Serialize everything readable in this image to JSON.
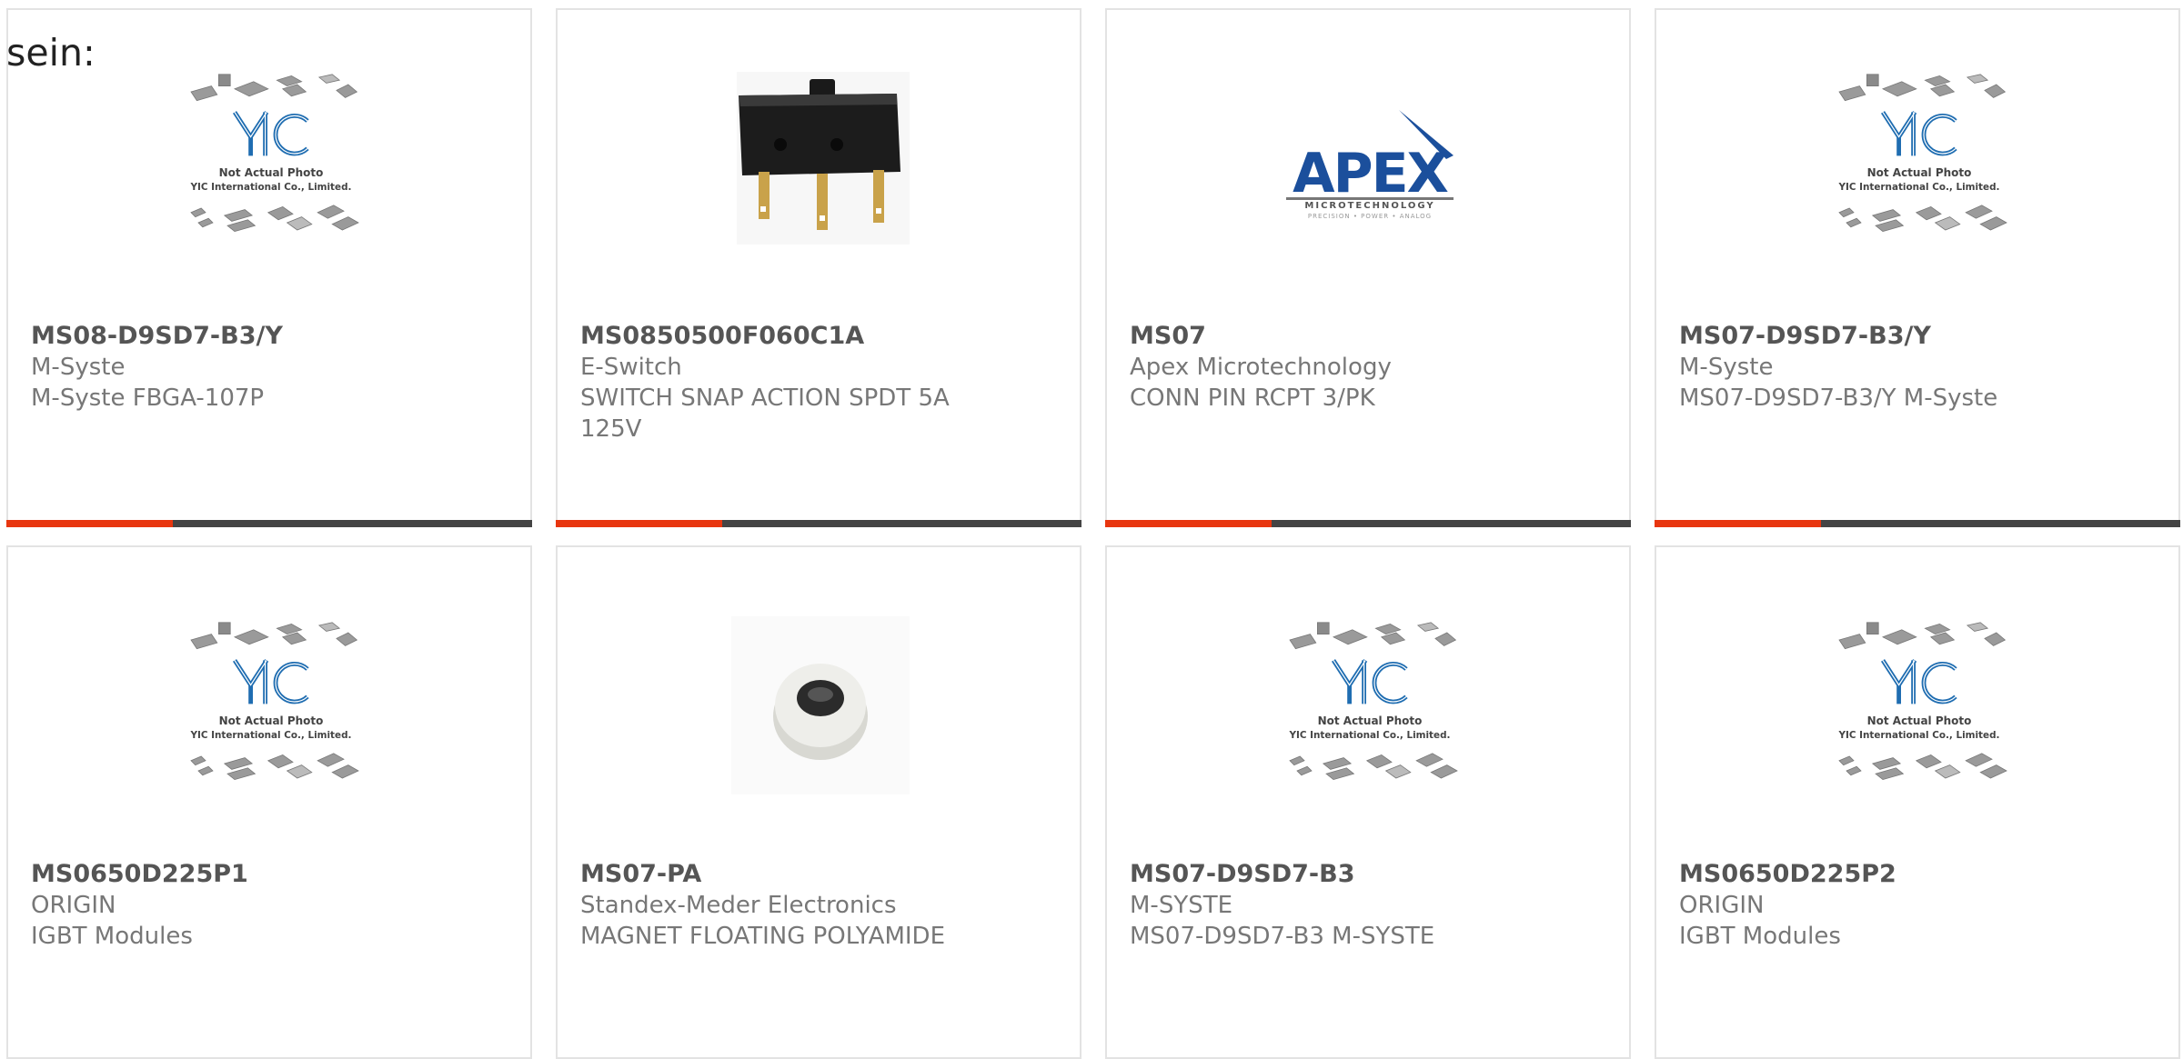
{
  "heading": "sein:",
  "colors": {
    "accent": "#e8360f",
    "bar": "#444444",
    "border": "#e3e3e3",
    "yic_blue": "#1f6db1",
    "apex_blue": "#1b4f9c"
  },
  "placeholder": {
    "line1": "Not Actual Photo",
    "line2": "YIC International Co., Limited.",
    "logo": "YIC"
  },
  "apex_logo": {
    "name": "APEX",
    "tagline": "MICROTECHNOLOGY",
    "sub": "PRECISION • POWER • ANALOG"
  },
  "products": [
    {
      "part_number": "MS08-D9SD7-B3/Y",
      "manufacturer": "M-Syste",
      "description": "M-Syste FBGA-107P",
      "image": "not-actual-photo"
    },
    {
      "part_number": "MS0850500F060C1A",
      "manufacturer": "E-Switch",
      "description": "SWITCH SNAP ACTION SPDT 5A 125V",
      "image": "snap-switch"
    },
    {
      "part_number": "MS07",
      "manufacturer": "Apex Microtechnology",
      "description": "CONN PIN RCPT 3/PK",
      "image": "apex-logo"
    },
    {
      "part_number": "MS07-D9SD7-B3/Y",
      "manufacturer": "M-Syste",
      "description": "MS07-D9SD7-B3/Y M-Syste",
      "image": "not-actual-photo"
    },
    {
      "part_number": "MS0650D225P1",
      "manufacturer": "ORIGIN",
      "description": "IGBT Modules",
      "image": "not-actual-photo"
    },
    {
      "part_number": "MS07-PA",
      "manufacturer": "Standex-Meder Electronics",
      "description": "MAGNET FLOATING POLYAMIDE",
      "image": "magnet"
    },
    {
      "part_number": "MS07-D9SD7-B3",
      "manufacturer": "M-SYSTE",
      "description": "MS07-D9SD7-B3 M-SYSTE",
      "image": "not-actual-photo"
    },
    {
      "part_number": "MS0650D225P2",
      "manufacturer": "ORIGIN",
      "description": "IGBT Modules",
      "image": "not-actual-photo"
    }
  ]
}
